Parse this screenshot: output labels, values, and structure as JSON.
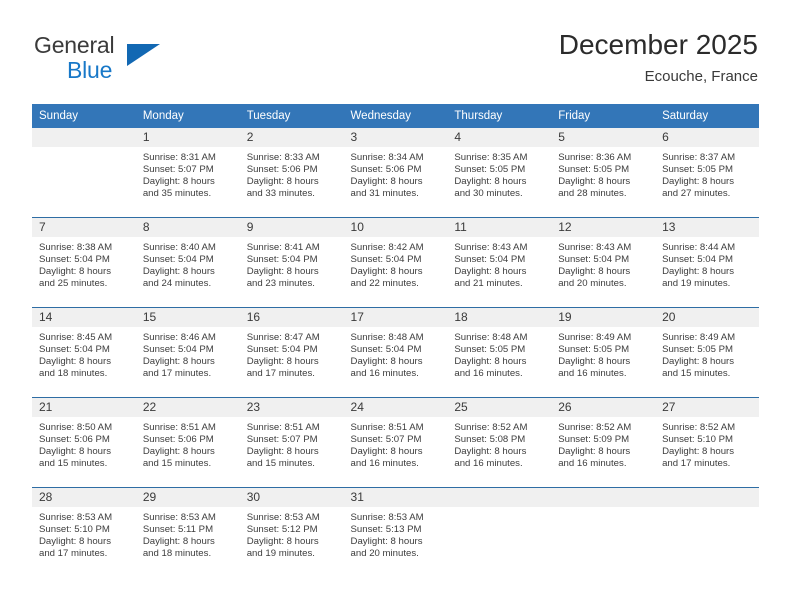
{
  "brand": {
    "name_line1": "General",
    "name_line2": "Blue",
    "accent_color": "#1268b3"
  },
  "header": {
    "title": "December 2025",
    "subtitle": "Ecouche, France"
  },
  "theme": {
    "header_row_bg": "#3376b8",
    "daynum_band_bg": "#f0f0f0",
    "row_divider": "#2e6da4",
    "text": "#3d3d3d"
  },
  "weekday_headers": [
    "Sunday",
    "Monday",
    "Tuesday",
    "Wednesday",
    "Thursday",
    "Friday",
    "Saturday"
  ],
  "weeks": [
    [
      {
        "day": "",
        "sunrise": "",
        "sunset": "",
        "daylight_line1": "",
        "daylight_line2": ""
      },
      {
        "day": "1",
        "sunrise": "Sunrise: 8:31 AM",
        "sunset": "Sunset: 5:07 PM",
        "daylight_line1": "Daylight: 8 hours",
        "daylight_line2": "and 35 minutes."
      },
      {
        "day": "2",
        "sunrise": "Sunrise: 8:33 AM",
        "sunset": "Sunset: 5:06 PM",
        "daylight_line1": "Daylight: 8 hours",
        "daylight_line2": "and 33 minutes."
      },
      {
        "day": "3",
        "sunrise": "Sunrise: 8:34 AM",
        "sunset": "Sunset: 5:06 PM",
        "daylight_line1": "Daylight: 8 hours",
        "daylight_line2": "and 31 minutes."
      },
      {
        "day": "4",
        "sunrise": "Sunrise: 8:35 AM",
        "sunset": "Sunset: 5:05 PM",
        "daylight_line1": "Daylight: 8 hours",
        "daylight_line2": "and 30 minutes."
      },
      {
        "day": "5",
        "sunrise": "Sunrise: 8:36 AM",
        "sunset": "Sunset: 5:05 PM",
        "daylight_line1": "Daylight: 8 hours",
        "daylight_line2": "and 28 minutes."
      },
      {
        "day": "6",
        "sunrise": "Sunrise: 8:37 AM",
        "sunset": "Sunset: 5:05 PM",
        "daylight_line1": "Daylight: 8 hours",
        "daylight_line2": "and 27 minutes."
      }
    ],
    [
      {
        "day": "7",
        "sunrise": "Sunrise: 8:38 AM",
        "sunset": "Sunset: 5:04 PM",
        "daylight_line1": "Daylight: 8 hours",
        "daylight_line2": "and 25 minutes."
      },
      {
        "day": "8",
        "sunrise": "Sunrise: 8:40 AM",
        "sunset": "Sunset: 5:04 PM",
        "daylight_line1": "Daylight: 8 hours",
        "daylight_line2": "and 24 minutes."
      },
      {
        "day": "9",
        "sunrise": "Sunrise: 8:41 AM",
        "sunset": "Sunset: 5:04 PM",
        "daylight_line1": "Daylight: 8 hours",
        "daylight_line2": "and 23 minutes."
      },
      {
        "day": "10",
        "sunrise": "Sunrise: 8:42 AM",
        "sunset": "Sunset: 5:04 PM",
        "daylight_line1": "Daylight: 8 hours",
        "daylight_line2": "and 22 minutes."
      },
      {
        "day": "11",
        "sunrise": "Sunrise: 8:43 AM",
        "sunset": "Sunset: 5:04 PM",
        "daylight_line1": "Daylight: 8 hours",
        "daylight_line2": "and 21 minutes."
      },
      {
        "day": "12",
        "sunrise": "Sunrise: 8:43 AM",
        "sunset": "Sunset: 5:04 PM",
        "daylight_line1": "Daylight: 8 hours",
        "daylight_line2": "and 20 minutes."
      },
      {
        "day": "13",
        "sunrise": "Sunrise: 8:44 AM",
        "sunset": "Sunset: 5:04 PM",
        "daylight_line1": "Daylight: 8 hours",
        "daylight_line2": "and 19 minutes."
      }
    ],
    [
      {
        "day": "14",
        "sunrise": "Sunrise: 8:45 AM",
        "sunset": "Sunset: 5:04 PM",
        "daylight_line1": "Daylight: 8 hours",
        "daylight_line2": "and 18 minutes."
      },
      {
        "day": "15",
        "sunrise": "Sunrise: 8:46 AM",
        "sunset": "Sunset: 5:04 PM",
        "daylight_line1": "Daylight: 8 hours",
        "daylight_line2": "and 17 minutes."
      },
      {
        "day": "16",
        "sunrise": "Sunrise: 8:47 AM",
        "sunset": "Sunset: 5:04 PM",
        "daylight_line1": "Daylight: 8 hours",
        "daylight_line2": "and 17 minutes."
      },
      {
        "day": "17",
        "sunrise": "Sunrise: 8:48 AM",
        "sunset": "Sunset: 5:04 PM",
        "daylight_line1": "Daylight: 8 hours",
        "daylight_line2": "and 16 minutes."
      },
      {
        "day": "18",
        "sunrise": "Sunrise: 8:48 AM",
        "sunset": "Sunset: 5:05 PM",
        "daylight_line1": "Daylight: 8 hours",
        "daylight_line2": "and 16 minutes."
      },
      {
        "day": "19",
        "sunrise": "Sunrise: 8:49 AM",
        "sunset": "Sunset: 5:05 PM",
        "daylight_line1": "Daylight: 8 hours",
        "daylight_line2": "and 16 minutes."
      },
      {
        "day": "20",
        "sunrise": "Sunrise: 8:49 AM",
        "sunset": "Sunset: 5:05 PM",
        "daylight_line1": "Daylight: 8 hours",
        "daylight_line2": "and 15 minutes."
      }
    ],
    [
      {
        "day": "21",
        "sunrise": "Sunrise: 8:50 AM",
        "sunset": "Sunset: 5:06 PM",
        "daylight_line1": "Daylight: 8 hours",
        "daylight_line2": "and 15 minutes."
      },
      {
        "day": "22",
        "sunrise": "Sunrise: 8:51 AM",
        "sunset": "Sunset: 5:06 PM",
        "daylight_line1": "Daylight: 8 hours",
        "daylight_line2": "and 15 minutes."
      },
      {
        "day": "23",
        "sunrise": "Sunrise: 8:51 AM",
        "sunset": "Sunset: 5:07 PM",
        "daylight_line1": "Daylight: 8 hours",
        "daylight_line2": "and 15 minutes."
      },
      {
        "day": "24",
        "sunrise": "Sunrise: 8:51 AM",
        "sunset": "Sunset: 5:07 PM",
        "daylight_line1": "Daylight: 8 hours",
        "daylight_line2": "and 16 minutes."
      },
      {
        "day": "25",
        "sunrise": "Sunrise: 8:52 AM",
        "sunset": "Sunset: 5:08 PM",
        "daylight_line1": "Daylight: 8 hours",
        "daylight_line2": "and 16 minutes."
      },
      {
        "day": "26",
        "sunrise": "Sunrise: 8:52 AM",
        "sunset": "Sunset: 5:09 PM",
        "daylight_line1": "Daylight: 8 hours",
        "daylight_line2": "and 16 minutes."
      },
      {
        "day": "27",
        "sunrise": "Sunrise: 8:52 AM",
        "sunset": "Sunset: 5:10 PM",
        "daylight_line1": "Daylight: 8 hours",
        "daylight_line2": "and 17 minutes."
      }
    ],
    [
      {
        "day": "28",
        "sunrise": "Sunrise: 8:53 AM",
        "sunset": "Sunset: 5:10 PM",
        "daylight_line1": "Daylight: 8 hours",
        "daylight_line2": "and 17 minutes."
      },
      {
        "day": "29",
        "sunrise": "Sunrise: 8:53 AM",
        "sunset": "Sunset: 5:11 PM",
        "daylight_line1": "Daylight: 8 hours",
        "daylight_line2": "and 18 minutes."
      },
      {
        "day": "30",
        "sunrise": "Sunrise: 8:53 AM",
        "sunset": "Sunset: 5:12 PM",
        "daylight_line1": "Daylight: 8 hours",
        "daylight_line2": "and 19 minutes."
      },
      {
        "day": "31",
        "sunrise": "Sunrise: 8:53 AM",
        "sunset": "Sunset: 5:13 PM",
        "daylight_line1": "Daylight: 8 hours",
        "daylight_line2": "and 20 minutes."
      },
      {
        "day": "",
        "sunrise": "",
        "sunset": "",
        "daylight_line1": "",
        "daylight_line2": ""
      },
      {
        "day": "",
        "sunrise": "",
        "sunset": "",
        "daylight_line1": "",
        "daylight_line2": ""
      },
      {
        "day": "",
        "sunrise": "",
        "sunset": "",
        "daylight_line1": "",
        "daylight_line2": ""
      }
    ]
  ]
}
